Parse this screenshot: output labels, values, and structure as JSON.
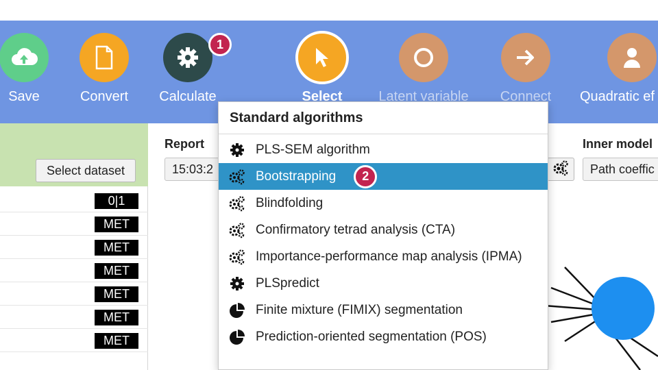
{
  "toolbar": {
    "tools": [
      {
        "label": "Save",
        "icon": "cloud-upload-icon",
        "color": "#5fce8a"
      },
      {
        "label": "Convert",
        "icon": "document-icon",
        "color": "#f5a623"
      },
      {
        "label": "Calculate",
        "icon": "gear-icon",
        "color": "#2d4a4a",
        "badge": "1"
      },
      {
        "label": "Select",
        "icon": "cursor-icon",
        "color": "#f5a623"
      },
      {
        "label": "Latent variable",
        "icon": "circle-icon",
        "color": "#d4976b"
      },
      {
        "label": "Connect",
        "icon": "arrow-right-icon",
        "color": "#d4976b"
      },
      {
        "label": "Quadratic ef",
        "icon": "person-icon",
        "color": "#d4976b"
      }
    ]
  },
  "left_panel": {
    "select_dataset_label": "Select dataset",
    "rows": [
      "0|1",
      "MET",
      "MET",
      "MET",
      "MET",
      "MET",
      "MET"
    ]
  },
  "main": {
    "report_label": "Report",
    "report_value": "15:03:2",
    "inner_model_label": "Inner model",
    "inner_model_value": "Path coeffic"
  },
  "dropdown": {
    "title": "Standard algorithms",
    "selected_badge": "2",
    "items": [
      {
        "label": "PLS-SEM algorithm",
        "icon": "gear-icon"
      },
      {
        "label": "Bootstrapping",
        "icon": "gears-icon",
        "selected": true
      },
      {
        "label": "Blindfolding",
        "icon": "gears-icon"
      },
      {
        "label": "Confirmatory tetrad analysis (CTA)",
        "icon": "gears-icon"
      },
      {
        "label": "Importance-performance map analysis (IPMA)",
        "icon": "gears-icon"
      },
      {
        "label": "PLSpredict",
        "icon": "gear-icon"
      },
      {
        "label": "Finite mixture (FIMIX) segmentation",
        "icon": "pie-chart-icon"
      },
      {
        "label": "Prediction-oriented segmentation (POS)",
        "icon": "pie-chart-icon"
      }
    ]
  },
  "colors": {
    "toolbar_bg": "#6f95e2",
    "selected_item": "#2f93c7",
    "badge": "#c2244f",
    "node": "#1d8ff0"
  }
}
